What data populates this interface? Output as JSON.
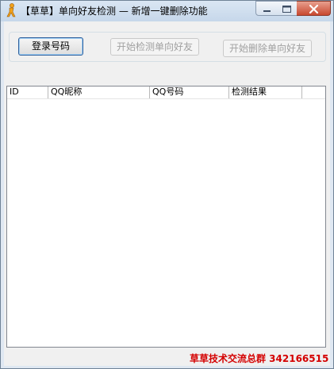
{
  "window": {
    "title": "【草草】单向好友检测 — 新增一键删除功能"
  },
  "buttons": {
    "login": "登录号码",
    "start_check": "开始检测单向好友",
    "start_delete": "开始删除单向好友"
  },
  "table": {
    "columns": [
      "ID",
      "QQ昵称",
      "QQ号码",
      "检测结果"
    ],
    "rows": []
  },
  "footer": {
    "group_text": "草草技术交流总群  342166515"
  },
  "colors": {
    "footer_text": "#d40000",
    "disabled_text": "#a0a0a0"
  }
}
